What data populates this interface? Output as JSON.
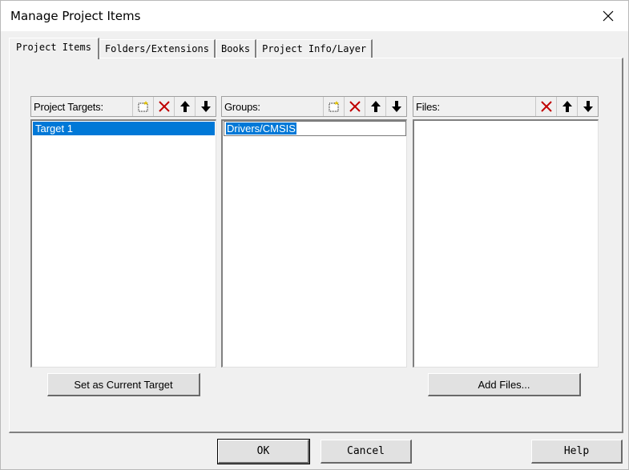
{
  "window": {
    "title": "Manage Project Items"
  },
  "tabs": [
    {
      "label": "Project Items",
      "active": true
    },
    {
      "label": "Folders/Extensions",
      "active": false
    },
    {
      "label": "Books",
      "active": false
    },
    {
      "label": "Project Info/Layer",
      "active": false
    }
  ],
  "targets": {
    "label": "Project Targets:",
    "items": [
      "Target 1"
    ]
  },
  "groups": {
    "label": "Groups:",
    "items": [
      "Drivers/CMSIS"
    ]
  },
  "files": {
    "label": "Files:",
    "items": []
  },
  "buttons": {
    "set_current": "Set as Current Target",
    "add_files": "Add Files...",
    "ok": "OK",
    "cancel": "Cancel",
    "help": "Help"
  },
  "colors": {
    "selection": "#0078d7",
    "delete": "#c00000"
  },
  "icons": [
    "new-icon",
    "delete-icon",
    "move-up-icon",
    "move-down-icon",
    "close-icon"
  ]
}
